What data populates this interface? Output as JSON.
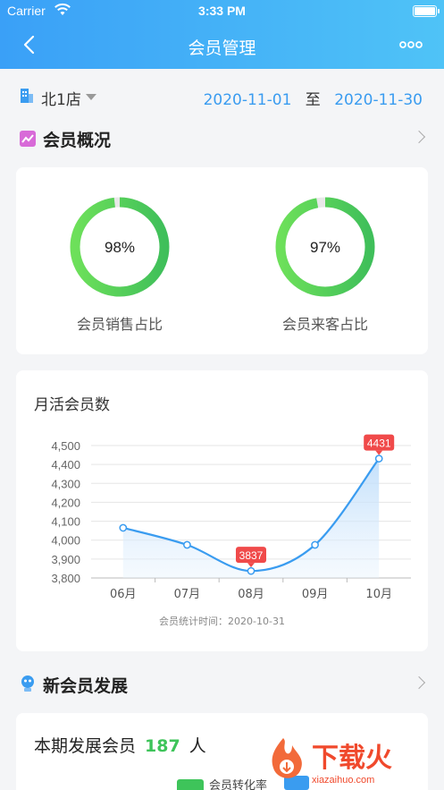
{
  "status_bar": {
    "carrier": "Carrier",
    "time": "3:33 PM"
  },
  "nav": {
    "title": "会员管理",
    "back_icon": "chevron-left-icon",
    "more_icon": "more-dots-icon"
  },
  "filter": {
    "store": "北1店",
    "date_start": "2020-11-01",
    "to": "至",
    "date_end": "2020-11-30"
  },
  "overview": {
    "title": "会员概况",
    "rings": [
      {
        "value": "98%",
        "fraction": 0.98,
        "label": "会员销售占比"
      },
      {
        "value": "97%",
        "fraction": 0.97,
        "label": "会员来客占比"
      }
    ]
  },
  "monthly": {
    "title": "月活会员数",
    "footnote": "会员统计时间：2020-10-31"
  },
  "chart_data": {
    "type": "area",
    "title": "月活会员数",
    "categories": [
      "06月",
      "07月",
      "08月",
      "09月",
      "10月"
    ],
    "values": [
      4065,
      3975,
      3837,
      3975,
      4431
    ],
    "ylim": [
      3800,
      4500
    ],
    "yticks": [
      "3,800",
      "3,900",
      "4,000",
      "4,100",
      "4,200",
      "4,300",
      "4,400",
      "4,500"
    ],
    "ytick_values": [
      3800,
      3900,
      4000,
      4100,
      4200,
      4300,
      4400,
      4500
    ],
    "annotations": [
      {
        "index": 2,
        "text": "3837"
      },
      {
        "index": 4,
        "text": "4431"
      }
    ],
    "grid": true,
    "line_color": "#3a9cf0",
    "annotation_color": "#f04a4a"
  },
  "growth": {
    "title": "新会员发展",
    "count_label": "本期发展会员",
    "count": "187",
    "unit": "人",
    "legend": [
      {
        "label": "会员转化率",
        "color": "#3ec45a"
      },
      {
        "label": "",
        "color": "#3a9cf0"
      }
    ]
  },
  "watermark": {
    "main": "下载火",
    "sub": "xiazaihuo.com"
  },
  "colors": {
    "accent": "#3a9cf0",
    "green": "#3ec45a",
    "header_start": "#3aa0f7",
    "header_end": "#4fc3f7"
  }
}
